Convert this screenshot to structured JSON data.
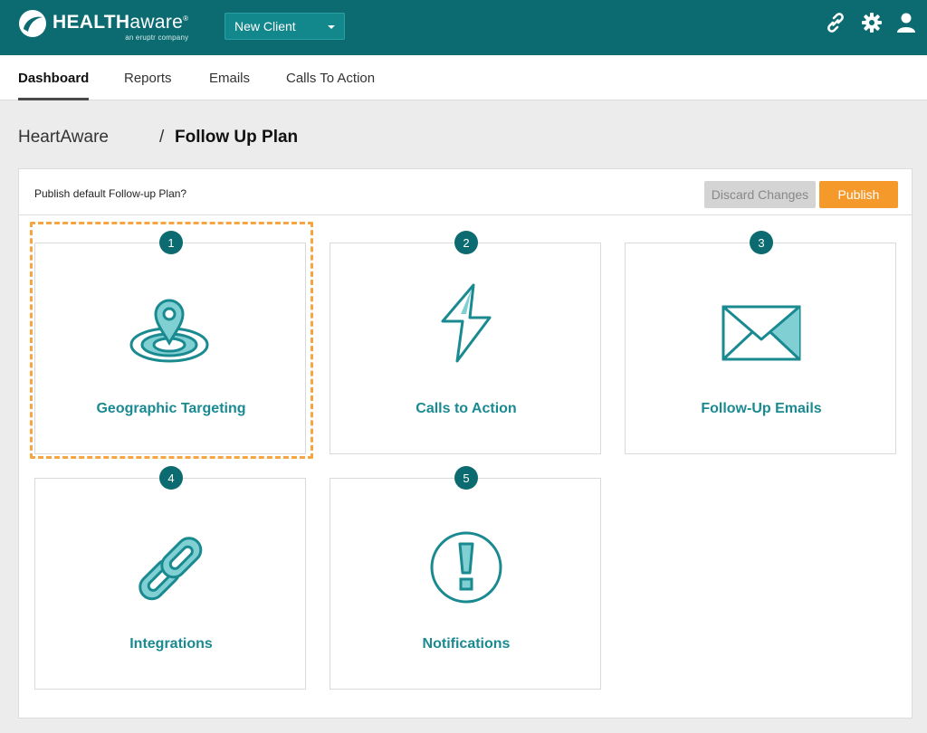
{
  "header": {
    "logo_word_bold": "HEALTH",
    "logo_word_light": "aware",
    "logo_reg": "®",
    "logo_sub": "an eruptr company",
    "client_select": "New Client",
    "icons": [
      "link-icon",
      "gear-icon",
      "user-icon"
    ]
  },
  "nav": {
    "tabs": [
      {
        "label": "Dashboard",
        "active": true
      },
      {
        "label": "Reports",
        "active": false
      },
      {
        "label": "Emails",
        "active": false
      },
      {
        "label": "Calls To Action",
        "active": false
      }
    ]
  },
  "breadcrumb": {
    "root": "HeartAware",
    "separator": "/",
    "current": "Follow Up Plan"
  },
  "panel": {
    "question": "Publish default Follow-up Plan?",
    "discard_label": "Discard Changes",
    "publish_label": "Publish"
  },
  "steps": [
    {
      "number": "1",
      "label": "Geographic Targeting",
      "icon": "map-pin-target-icon",
      "highlighted": true
    },
    {
      "number": "2",
      "label": "Calls to Action",
      "icon": "lightning-bolt-icon",
      "highlighted": false
    },
    {
      "number": "3",
      "label": "Follow-Up Emails",
      "icon": "envelope-icon",
      "highlighted": false
    },
    {
      "number": "4",
      "label": "Integrations",
      "icon": "chain-link-icon",
      "highlighted": false
    },
    {
      "number": "5",
      "label": "Notifications",
      "icon": "exclamation-circle-icon",
      "highlighted": false
    }
  ],
  "colors": {
    "header_bg": "#0b6b70",
    "accent_teal": "#1a8a91",
    "icon_fill": "#7fcfd3",
    "publish": "#f6992b",
    "highlight_border": "#f6a540"
  }
}
